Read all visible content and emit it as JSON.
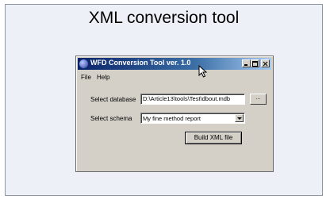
{
  "slide": {
    "title": "XML conversion tool"
  },
  "window": {
    "title": "WFD Conversion Tool ver. 1.0",
    "icon": "app-globe-icon",
    "controls": [
      "minimize-icon",
      "maximize-icon",
      "close-icon"
    ]
  },
  "menu": {
    "file": "File",
    "help": "Help"
  },
  "form": {
    "database_label": "Select database",
    "database_path": "D:\\Article13\\tools\\Test\\dbout.mdb",
    "browse_label": "...",
    "schema_label": "Select schema",
    "schema_value": "My fine method report",
    "build_label": "Build XML file"
  },
  "cursor": {
    "icon": "mouse-pointer-icon"
  }
}
